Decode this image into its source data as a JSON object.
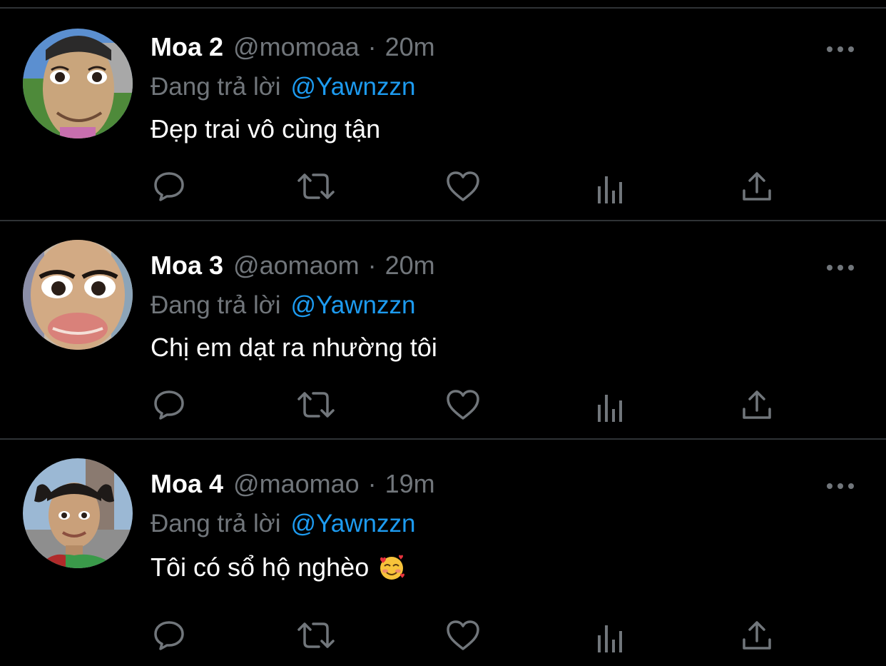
{
  "colors": {
    "background": "#000000",
    "divider": "#2f3336",
    "name": "#ffffff",
    "muted": "#71767b",
    "link": "#1d9bf0"
  },
  "tweets": [
    {
      "name": "Moa 2",
      "handle": "@momoaa",
      "separator": "·",
      "time": "20m",
      "reply_prefix": "Đang trả lời",
      "reply_handle": "@Yawnzzn",
      "text": "Đẹp trai vô cùng tận",
      "emoji": ""
    },
    {
      "name": "Moa 3",
      "handle": "@aomaom",
      "separator": "·",
      "time": "20m",
      "reply_prefix": "Đang trả lời",
      "reply_handle": "@Yawnzzn",
      "text": "Chị em dạt ra nhường tôi",
      "emoji": ""
    },
    {
      "name": "Moa 4",
      "handle": "@maomao",
      "separator": "·",
      "time": "19m",
      "reply_prefix": "Đang trả lời",
      "reply_handle": "@Yawnzzn",
      "text": "Tôi có sổ hộ nghèo",
      "emoji": "smiling-face-with-hearts-icon"
    }
  ],
  "icons": {
    "more": "more-horizontal-icon",
    "reply": "reply-bubble-icon",
    "retweet": "retweet-icon",
    "like": "heart-icon",
    "views": "views-bar-chart-icon",
    "share": "share-upload-icon"
  }
}
